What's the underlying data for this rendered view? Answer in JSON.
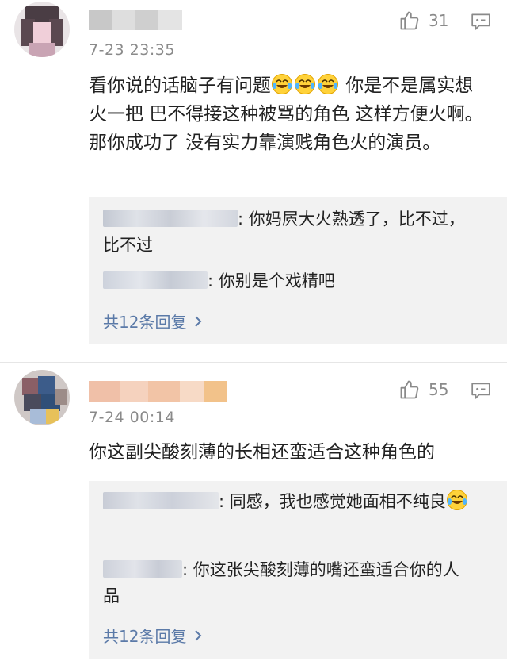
{
  "comments": [
    {
      "time": "7-23 23:35",
      "likes": "31",
      "content_text": "看你说的话脑子有问题",
      "content_text_2": " 你是不是属实想火一把 巴不得接这种被骂的角色 这样方便火啊。那你成功了 没有实力靠演贱角色火的演员。",
      "emoji": "laughing-crying-emoji",
      "replies": [
        {
          "text": ": 你妈屄大火熟透了，比不过，比不过"
        },
        {
          "text": ": 你别是个戏精吧"
        }
      ],
      "more_label": "共12条回复"
    },
    {
      "time": "7-24 00:14",
      "likes": "55",
      "content_text": "你这副尖酸刻薄的长相还蛮适合这种角色的",
      "replies": [
        {
          "text": ": 同感，我也感觉她面相不纯良",
          "emoji": "laughing-crying-emoji"
        },
        {
          "text": ": 你这张尖酸刻薄的嘴还蛮适合你的人品"
        }
      ],
      "more_label": "共12条回复"
    }
  ],
  "colors": {
    "link": "#5b7aa8",
    "muted": "#8a8a8a",
    "reply_bg": "#f2f2f2"
  }
}
